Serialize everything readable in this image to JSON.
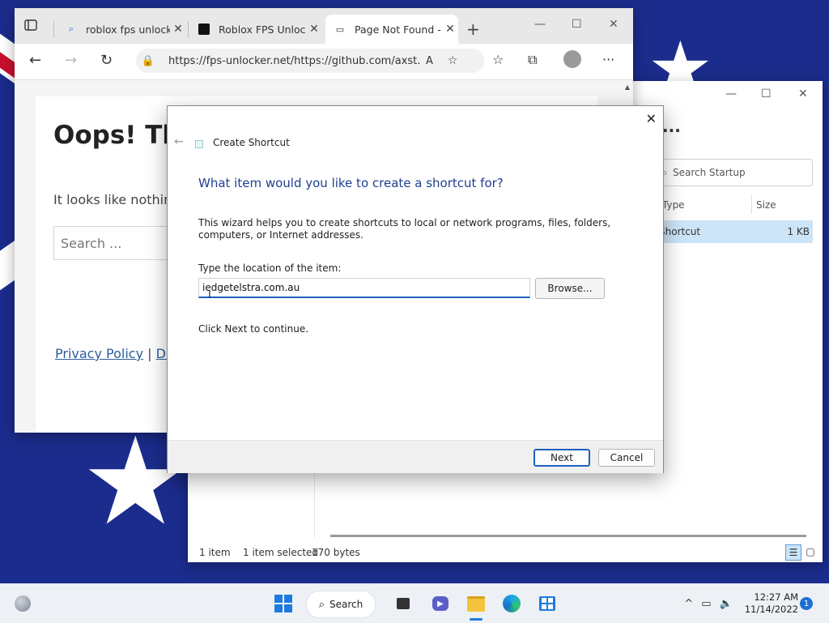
{
  "browser": {
    "tabs": [
      {
        "title": "roblox fps unlocker",
        "favicon": "search-icon"
      },
      {
        "title": "Roblox FPS Unlocker",
        "favicon": "github-icon"
      },
      {
        "title": "Page Not Found - F",
        "favicon": "page-icon"
      }
    ],
    "url": "https://fps-unlocker.net/https://github.com/axst...",
    "page": {
      "heading": "Oops! Tha",
      "body": "It looks like nothing",
      "search_placeholder": "Search ...",
      "footer_link1": "Privacy Policy",
      "footer_sep": "|",
      "footer_link2": "DM"
    }
  },
  "explorer": {
    "title": "...",
    "search_placeholder": "Search Startup",
    "columns": [
      "Type",
      "Size"
    ],
    "row": {
      "type": "Shortcut",
      "size": "1 KB"
    },
    "status": {
      "items": "1 item",
      "selected": "1 item selected",
      "size": "170 bytes"
    }
  },
  "dialog": {
    "title": "Create Shortcut",
    "heading": "What item would you like to create a shortcut for?",
    "description": "This wizard helps you to create shortcuts to local or network programs, files, folders, computers, or Internet addresses.",
    "location_label": "Type the location of the item:",
    "location_value": "iedgetelstra.com.au",
    "browse_label": "Browse...",
    "continue_text": "Click Next to continue.",
    "next_label": "Next",
    "cancel_label": "Cancel"
  },
  "taskbar": {
    "search_label": "Search",
    "time": "12:27 AM",
    "date": "11/14/2022",
    "notification_count": "1"
  },
  "colors": {
    "accent": "#1e5fbf",
    "heading_blue": "#1f3f8f",
    "wallpaper_blue": "#1b2c8c",
    "wallpaper_red": "#c8102e"
  }
}
